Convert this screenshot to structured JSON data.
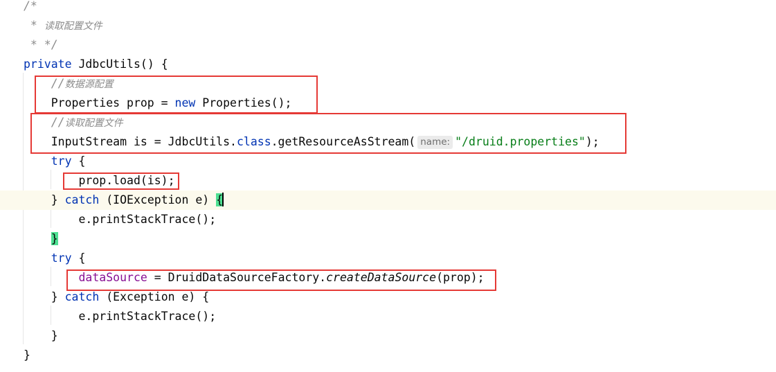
{
  "editor": {
    "lines": [
      {
        "id": "l0",
        "segments": [
          {
            "cls": "cm",
            "text": "/*"
          }
        ]
      },
      {
        "id": "l1",
        "segments": [
          {
            "cls": "cm",
            "text": " * "
          },
          {
            "cls": "cm-cn",
            "text": "读取配置文件"
          }
        ]
      },
      {
        "id": "l2",
        "segments": [
          {
            "cls": "cm",
            "text": " * */"
          }
        ]
      },
      {
        "id": "l3",
        "segments": [
          {
            "cls": "kw",
            "text": "private "
          },
          {
            "cls": "",
            "text": "JdbcUtils() {"
          }
        ]
      },
      {
        "id": "l4",
        "segments": [
          {
            "cls": "cm",
            "text": "    //"
          },
          {
            "cls": "cm-cn",
            "text": "数据源配置"
          }
        ]
      },
      {
        "id": "l5",
        "segments": [
          {
            "cls": "",
            "text": "    Properties prop = "
          },
          {
            "cls": "kw",
            "text": "new "
          },
          {
            "cls": "",
            "text": "Properties();"
          }
        ]
      },
      {
        "id": "l6",
        "segments": [
          {
            "cls": "cm",
            "text": "    //"
          },
          {
            "cls": "cm-cn",
            "text": "读取配置文件"
          }
        ]
      },
      {
        "id": "l7",
        "segments": [
          {
            "cls": "",
            "text": "    InputStream is = JdbcUtils."
          },
          {
            "cls": "kw",
            "text": "class"
          },
          {
            "cls": "",
            "text": ".getResourceAsStream("
          },
          {
            "cls": "hint",
            "text": "name:"
          },
          {
            "cls": "str",
            "text": "\"/druid.properties\""
          },
          {
            "cls": "",
            "text": ");"
          }
        ]
      },
      {
        "id": "l8",
        "segments": [
          {
            "cls": "kw",
            "text": "    try "
          },
          {
            "cls": "",
            "text": "{"
          }
        ]
      },
      {
        "id": "l9",
        "segments": [
          {
            "cls": "",
            "text": "        prop.load(is);"
          }
        ]
      },
      {
        "id": "l10",
        "current": true,
        "segments": [
          {
            "cls": "",
            "text": "    } "
          },
          {
            "cls": "kw",
            "text": "catch "
          },
          {
            "cls": "",
            "text": "(IOException e) "
          },
          {
            "cls": "brace-match",
            "text": "{"
          },
          {
            "cls": "caret",
            "text": ""
          }
        ]
      },
      {
        "id": "l11",
        "segments": [
          {
            "cls": "",
            "text": "        e.printStackTrace();"
          }
        ]
      },
      {
        "id": "l12",
        "segments": [
          {
            "cls": "",
            "text": "    "
          },
          {
            "cls": "brace-match",
            "text": "}"
          }
        ]
      },
      {
        "id": "l13",
        "segments": [
          {
            "cls": "kw",
            "text": "    try "
          },
          {
            "cls": "",
            "text": "{"
          }
        ]
      },
      {
        "id": "l14",
        "segments": [
          {
            "cls": "",
            "text": "        "
          },
          {
            "cls": "fld",
            "text": "dataSource"
          },
          {
            "cls": "",
            "text": " = DruidDataSourceFactory."
          },
          {
            "cls": "ital",
            "text": "createDataSource"
          },
          {
            "cls": "",
            "text": "(prop);"
          }
        ]
      },
      {
        "id": "l15",
        "segments": [
          {
            "cls": "",
            "text": "    } "
          },
          {
            "cls": "kw",
            "text": "catch "
          },
          {
            "cls": "",
            "text": "(Exception e) {"
          }
        ]
      },
      {
        "id": "l16",
        "segments": [
          {
            "cls": "",
            "text": "        e.printStackTrace();"
          }
        ]
      },
      {
        "id": "l17",
        "segments": [
          {
            "cls": "",
            "text": "    }"
          }
        ]
      },
      {
        "id": "l18",
        "segments": [
          {
            "cls": "",
            "text": "}"
          }
        ]
      }
    ]
  }
}
